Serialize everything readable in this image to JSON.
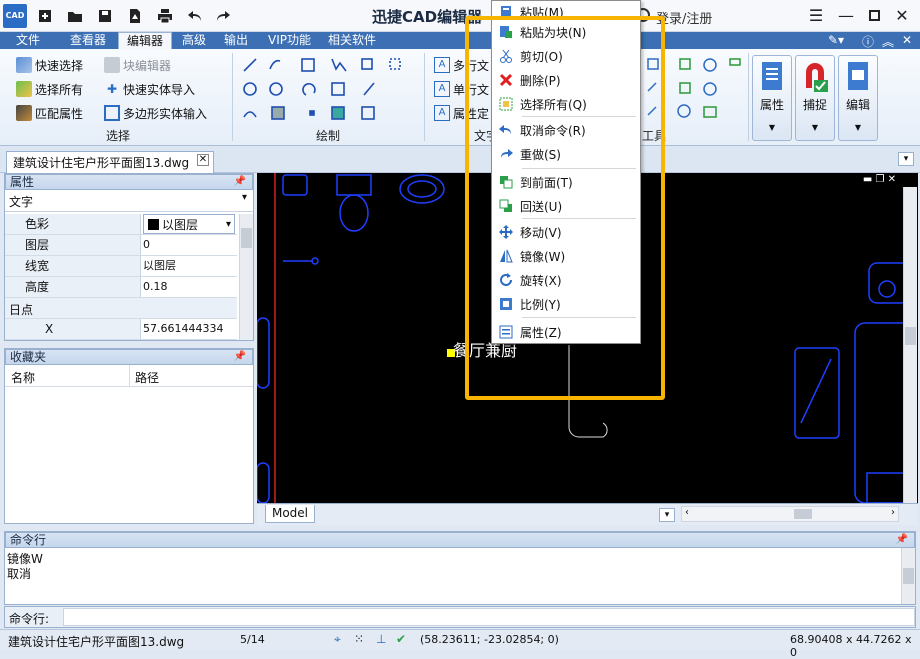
{
  "app": {
    "title": "迅捷CAD编辑器",
    "logo_text": "CAD",
    "login": "登录/注册"
  },
  "ribbon_tabs": [
    "文件",
    "查看器",
    "编辑器",
    "高级",
    "输出",
    "VIP功能",
    "相关软件"
  ],
  "select_group": {
    "title": "选择",
    "buttons": [
      "快速选择",
      "选择所有",
      "匹配属性",
      "块编辑器",
      "快速实体导入",
      "多边形实体输入"
    ]
  },
  "draw_group": {
    "title": "绘制"
  },
  "text_group": {
    "buttons": [
      "多行文",
      "单行文",
      "属性定"
    ],
    "title": "文字"
  },
  "tools_group": {
    "title": "工具"
  },
  "big_buttons": [
    "属性",
    "捕捉",
    "编辑"
  ],
  "document": {
    "tab_label": "建筑设计住宅户形平面图13.dwg"
  },
  "properties_panel": {
    "title": "属性",
    "object_type": "文字",
    "rows": [
      {
        "key": "色彩",
        "value": "以图层"
      },
      {
        "key": "图层",
        "value": "0"
      },
      {
        "key": "线宽",
        "value": "以图层"
      },
      {
        "key": "高度",
        "value": "0.18"
      }
    ],
    "section": "日点",
    "x_key": "X",
    "x_value": "57.661444334"
  },
  "favorites_panel": {
    "title": "收藏夹",
    "col_name": "名称",
    "col_path": "路径"
  },
  "canvas": {
    "model_tab": "Model",
    "text_label": "餐厅兼厨"
  },
  "command_panel": {
    "title": "命令行",
    "history": [
      "镜像W",
      "取消"
    ],
    "input_label": "命令行:"
  },
  "status": {
    "file": "建筑设计住宅户形平面图13.dwg",
    "page": "5/14",
    "coords": "(58.23611; -23.02854; 0)",
    "size": "68.90408 x 44.7262 x 0"
  },
  "context_menu": {
    "items": [
      {
        "label": "粘贴(M)",
        "icon": "paste-icon"
      },
      {
        "label": "粘贴为块(N)",
        "icon": "paste-block-icon"
      },
      {
        "label": "剪切(O)",
        "icon": "scissors-icon"
      },
      {
        "label": "删除(P)",
        "icon": "delete-x-icon"
      },
      {
        "label": "选择所有(Q)",
        "icon": "select-all-icon"
      },
      {
        "label": "取消命令(R)",
        "icon": "undo-icon"
      },
      {
        "label": "重做(S)",
        "icon": "redo-icon"
      },
      {
        "label": "到前面(T)",
        "icon": "bring-front-icon"
      },
      {
        "label": "回送(U)",
        "icon": "send-back-icon"
      },
      {
        "label": "移动(V)",
        "icon": "move-icon"
      },
      {
        "label": "镜像(W)",
        "icon": "mirror-icon"
      },
      {
        "label": "旋转(X)",
        "icon": "rotate-icon"
      },
      {
        "label": "比例(Y)",
        "icon": "scale-icon"
      },
      {
        "label": "属性(Z)",
        "icon": "properties-icon"
      }
    ]
  },
  "colors": {
    "accent": "#3c6fb3",
    "highlight": "#f7b500",
    "canvas_bg": "#000000",
    "cad_blue": "#1f3fff"
  }
}
